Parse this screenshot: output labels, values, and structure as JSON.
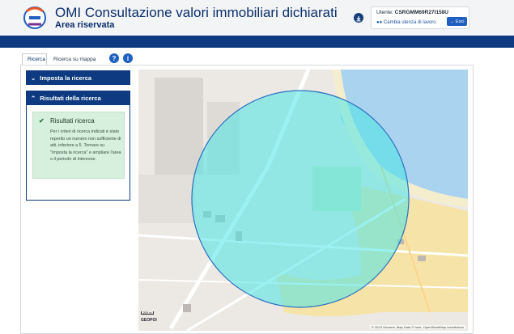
{
  "header": {
    "title": "OMI Consultazione valori immobiliari dichiarati",
    "subtitle": "Area riservata",
    "user_label": "Utente:",
    "user_code": "CSRGMM69R27I158U",
    "change_user": "Cambia utenza di lavoro",
    "exit": "Esci"
  },
  "tabs": [
    {
      "label": "Ricerca"
    },
    {
      "label": "Ricerca su mappa"
    }
  ],
  "help_icon": "?",
  "info_icon": "i",
  "sidebar": {
    "imposta_label": "Imposta la ricerca",
    "risultati_label": "Risultati della ricerca",
    "alert_title": "Risultati ricerca",
    "alert_text": "Per i criteri di ricerca indicati è stato reperito un numero non sufficiente di atti, inferiore a 5. Tornare su \"Imposta la ricerca\" e ampliare l'area o il periodo di interesse."
  },
  "map": {
    "scale_label": "200 m",
    "provider": "GEOPOI",
    "attribution": "© 2023 Geoserv, Map Data © here, OpenStreetMap contributors"
  },
  "colors": {
    "brand_blue": "#0d3a80",
    "alert_green": "#d7efdd",
    "sea": "#a9d3ee",
    "circle": "#49e6e6"
  }
}
